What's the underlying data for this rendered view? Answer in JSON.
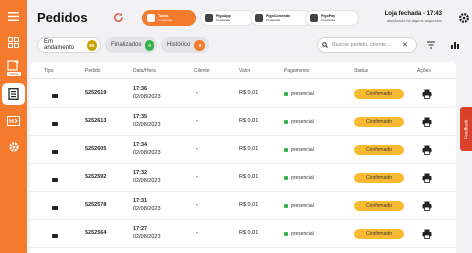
{
  "sidebar": {
    "items": [
      {
        "icon": "hamburger-menu-icon",
        "active": false
      },
      {
        "icon": "dashboard-grid-icon",
        "active": false
      },
      {
        "icon": "add-order-icon",
        "active": false,
        "badge": "NOVO"
      },
      {
        "icon": "orders-document-icon",
        "active": true
      },
      {
        "icon": "kds-icon",
        "active": false
      },
      {
        "icon": "settings-gear-icon",
        "active": false
      }
    ]
  },
  "header": {
    "title": "Pedidos",
    "sources": [
      {
        "name": "Todos",
        "count": "4 resposta",
        "active": true
      },
      {
        "name": "PigoApp",
        "count": "0 resposta",
        "active": false
      },
      {
        "name": "PigoComendo",
        "count": "0 resposta",
        "active": false
      },
      {
        "name": "PigoPay",
        "count": "0 resposta",
        "active": false
      }
    ],
    "store_status": "Loja fechada - 17:43",
    "store_updated": "atualizado há alguns segundos"
  },
  "tabs": [
    {
      "label": "Em andamento",
      "count": "85",
      "color": "#c6a400",
      "active": true
    },
    {
      "label": "Finalizados",
      "count": "0",
      "color": "#37b24d",
      "active": false
    },
    {
      "label": "Histórico",
      "count": "0",
      "color": "#f47a2e",
      "active": false
    }
  ],
  "search": {
    "placeholder": "Buscar pedido, cliente..."
  },
  "table": {
    "headers": [
      "Tipo",
      "Pedido",
      "Data/Hora",
      "Cliente",
      "Valor",
      "Pagamento",
      "Status",
      "Ações"
    ],
    "rows": [
      {
        "id": "5252619",
        "time": "17:36",
        "date": "02/08/2023",
        "client": "-",
        "value": "R$ 0,01",
        "payment": "presencial",
        "status": "Confirmado"
      },
      {
        "id": "5252613",
        "time": "17:35",
        "date": "02/08/2023",
        "client": "-",
        "value": "R$ 0,01",
        "payment": "presencial",
        "status": "Confirmado"
      },
      {
        "id": "5252605",
        "time": "17:34",
        "date": "02/08/2023",
        "client": "-",
        "value": "R$ 0,01",
        "payment": "presencial",
        "status": "Confirmado"
      },
      {
        "id": "5252592",
        "time": "17:32",
        "date": "02/08/2023",
        "client": "-",
        "value": "R$ 0,01",
        "payment": "presencial",
        "status": "Confirmado"
      },
      {
        "id": "5252578",
        "time": "17:31",
        "date": "02/08/2023",
        "client": "-",
        "value": "R$ 0,01",
        "payment": "presencial",
        "status": "Confirmado"
      },
      {
        "id": "5252564",
        "time": "17:27",
        "date": "02/08/2023",
        "client": "-",
        "value": "R$ 0,01",
        "payment": "presencial",
        "status": "Confirmado"
      }
    ]
  },
  "feedback_label": "Feedback",
  "colors": {
    "brand": "#f47a2e",
    "status": "#f9b932",
    "payment": "#37b24d"
  }
}
